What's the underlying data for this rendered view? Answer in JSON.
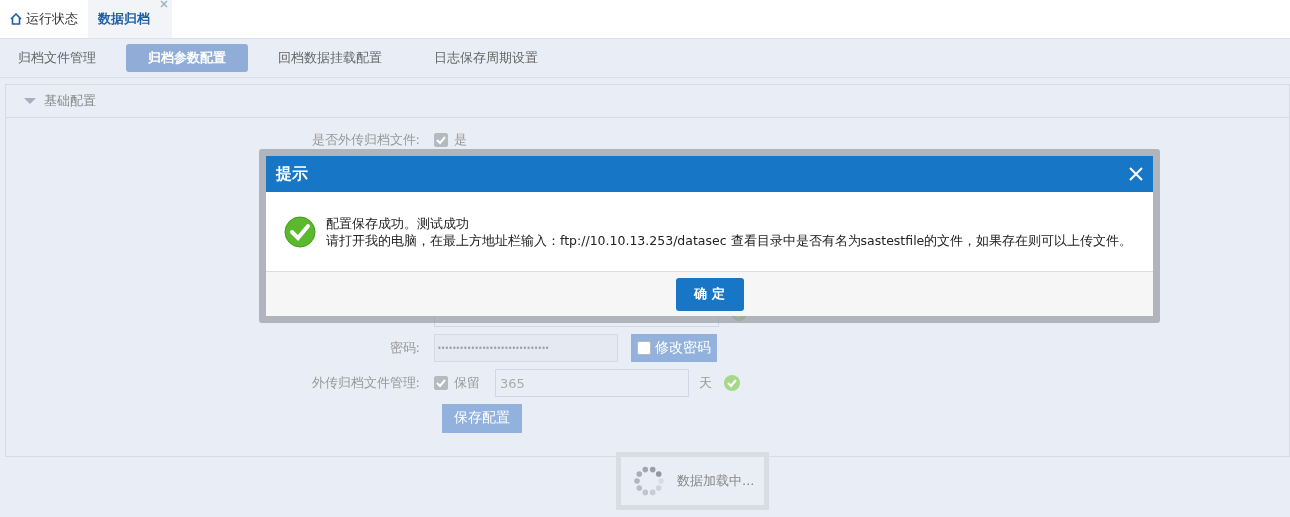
{
  "top_tabs": [
    {
      "label": "运行状态",
      "kind": "home",
      "selected": false
    },
    {
      "label": "数据归档",
      "selected": true,
      "closable": true
    }
  ],
  "sub_tabs": [
    {
      "label": "归档文件管理",
      "selected": false
    },
    {
      "label": "归档参数配置",
      "selected": true
    },
    {
      "label": "回档数据挂载配置",
      "selected": false
    },
    {
      "label": "日志保存周期设置",
      "selected": false
    }
  ],
  "panel": {
    "title": "基础配置",
    "expanded": true,
    "rows": [
      {
        "kind": "checkbox",
        "label": "是否外传归档文件:",
        "checked": true,
        "option": "是"
      },
      {
        "kind": "gap"
      },
      {
        "kind": "text",
        "valid": true
      },
      {
        "kind": "password",
        "label": "密码:",
        "value": "••••••••••••••••••••••••••••••",
        "button": "修改密码",
        "checked": false
      },
      {
        "kind": "retain",
        "label": "外传归档文件管理:",
        "checked": true,
        "option": "保留",
        "value": "365",
        "unit": "天",
        "valid": true
      }
    ],
    "save_button": "保存配置"
  },
  "loading": {
    "text": "数据加载中..."
  },
  "dialog": {
    "title": "提示",
    "lines": [
      "配置保存成功。测试成功",
      "请打开我的电脑，在最上方地址栏输入：ftp://10.10.13.253/datasec 查看目录中是否有名为sastestfile的文件，如果存在则可以上传文件。"
    ],
    "ok": "确 定"
  }
}
